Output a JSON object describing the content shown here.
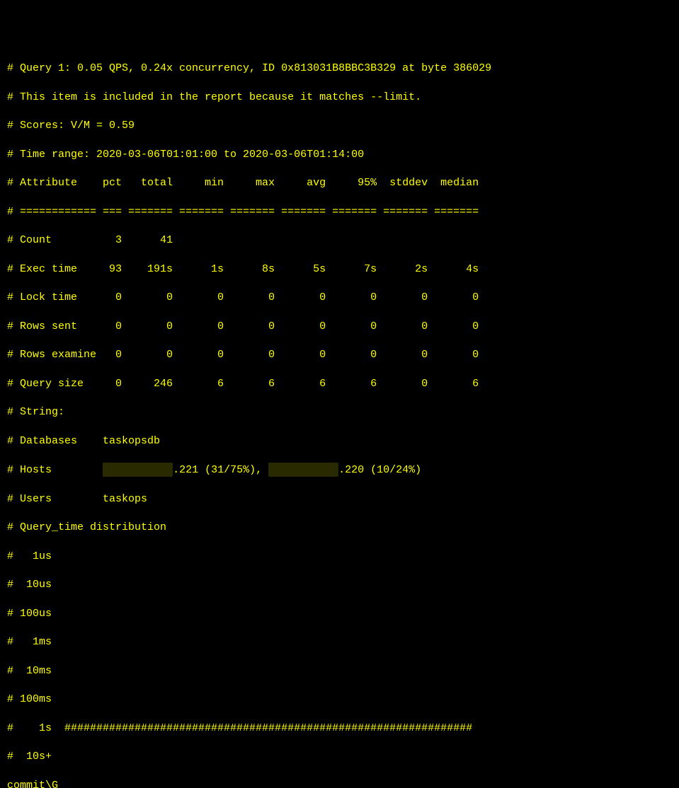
{
  "header": {
    "query_line": "# Query 1: 0.05 QPS, 0.24x concurrency, ID 0x813031B8BBC3B329 at byte 386029",
    "included_line": "# This item is included in the report because it matches --limit.",
    "scores_line": "# Scores: V/M = 0.59",
    "time_range_line": "# Time range: 2020-03-06T01:01:00 to 2020-03-06T01:14:00"
  },
  "table": {
    "header": "# Attribute    pct   total     min     max     avg     95%  stddev  median",
    "separator": "# ============ === ======= ======= ======= ======= ======= ======= =======",
    "rows": {
      "count": "# Count          3      41",
      "exec_time": "# Exec time     93    191s      1s      8s      5s      7s      2s      4s",
      "lock_time": "# Lock time      0       0       0       0       0       0       0       0",
      "rows_sent": "# Rows sent      0       0       0       0       0       0       0       0",
      "rows_examine": "# Rows examine   0       0       0       0       0       0       0       0",
      "query_size": "# Query size     0     246       6       6       6       6       0       6"
    }
  },
  "strings": {
    "string_label": "# String:",
    "databases": "# Databases    taskopsdb",
    "hosts_prefix": "# Hosts        ",
    "hosts_ip1_suffix": ".221 (31/75%), ",
    "hosts_ip2_suffix": ".220 (10/24%)",
    "hosts_redacted1": "xxxxxxxxxxx",
    "hosts_redacted2": "xxxxxxxxxxx",
    "users": "# Users        taskops"
  },
  "distribution": {
    "title": "# Query_time distribution",
    "rows": {
      "us1": "#   1us",
      "us10": "#  10us",
      "us100": "# 100us",
      "ms1": "#   1ms",
      "ms10": "#  10ms",
      "ms100": "# 100ms",
      "s1": "#    1s  ################################################################",
      "s10": "#  10s+"
    }
  },
  "footer": {
    "commit": "commit\\G"
  }
}
